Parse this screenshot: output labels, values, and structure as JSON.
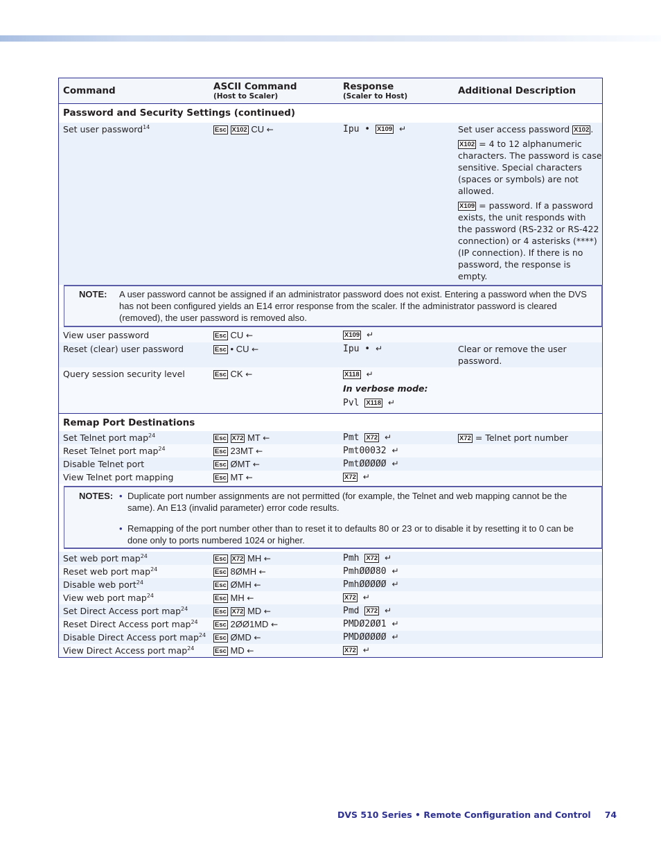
{
  "header": {
    "col_command": "Command",
    "col_ascii": "ASCII Command",
    "col_ascii_sub": "(Host to Scaler)",
    "col_response": "Response",
    "col_response_sub": "(Scaler to Host)",
    "col_description": "Additional Description"
  },
  "symbols": {
    "esc": "Esc",
    "x102": "X102",
    "x109": "X109",
    "x118": "X118",
    "x72": "X72",
    "enter_arrow": "←",
    "return_arrow": "↵",
    "bullet": "•"
  },
  "sections": {
    "password": {
      "title": "Password and Security Settings (continued)",
      "set_user_password": {
        "command": "Set user password",
        "footnote": "14",
        "ascii_suffix": "CU",
        "response_prefix": "Ipu •",
        "description_line1": "Set user access password",
        "description_x102": "= 4 to 12 alphanumeric characters. The password is case sensitive. Special characters (spaces or symbols) are not allowed.",
        "description_x109": "= password. If a password exists, the unit responds with the password (RS-232 or RS-422 connection) or 4 asterisks (****) (IP connection). If there is no password, the response is empty."
      },
      "note": {
        "label": "NOTE:",
        "text": "A user password cannot be assigned if an administrator password does not exist. Entering a password when the DVS has not been configured yields an E14 error response from the scaler. If the administrator password is cleared (removed), the user password is removed also."
      },
      "view_user_password": {
        "command": "View user password",
        "ascii_suffix": "CU"
      },
      "reset_user_password": {
        "command": "Reset (clear) user password",
        "ascii_suffix": "• CU",
        "response": "Ipu •",
        "description": "Clear or remove the user password."
      },
      "query_security": {
        "command": "Query session security level",
        "ascii_suffix": "CK",
        "verbose_label": "In verbose mode:",
        "verbose_prefix": "Pvl"
      }
    },
    "remap": {
      "title": "Remap Port Destinations",
      "telnet_rows": [
        {
          "command": "Set Telnet port map",
          "footnote": "24",
          "ascii_var": true,
          "ascii_suffix": "MT",
          "response_prefix": "Pmt",
          "response_var": true,
          "description_suffix": "= Telnet port number"
        },
        {
          "command": "Reset Telnet port map",
          "footnote": "24",
          "ascii_var": false,
          "ascii_suffix": "23MT",
          "response_prefix": "Pmt00032",
          "response_var": false
        },
        {
          "command": "Disable Telnet port",
          "footnote": "",
          "ascii_var": false,
          "ascii_suffix": "ØMT",
          "response_prefix": "PmtØØØØØ",
          "response_var": false
        },
        {
          "command": "View Telnet port mapping",
          "footnote": "",
          "ascii_var": false,
          "ascii_suffix": "MT",
          "response_prefix": "",
          "response_var": true
        }
      ],
      "notes": {
        "label": "NOTES:",
        "items": [
          "Duplicate port number assignments are not permitted (for example, the Telnet and web mapping cannot be the same). An E13 (invalid parameter) error code results.",
          "Remapping of the port number other than to reset it to defaults 80 or 23 or to disable it by resetting it to 0 can be done only to ports numbered 1024 or higher."
        ]
      },
      "web_rows": [
        {
          "command": "Set web port map",
          "footnote": "24",
          "ascii_var": true,
          "ascii_suffix": "MH",
          "response_prefix": "Pmh",
          "response_var": true
        },
        {
          "command": "Reset web port map",
          "footnote": "24",
          "ascii_var": false,
          "ascii_suffix": "8ØMH",
          "response_prefix": "PmhØØØ80",
          "response_var": false
        },
        {
          "command": "Disable web port",
          "footnote": "24",
          "ascii_var": false,
          "ascii_suffix": "ØMH",
          "response_prefix": "PmhØØØØØ",
          "response_var": false
        },
        {
          "command": "View web port map",
          "footnote": "24",
          "ascii_var": false,
          "ascii_suffix": "MH",
          "response_prefix": "",
          "response_var": true
        },
        {
          "command": "Set Direct Access port map",
          "footnote": "24",
          "ascii_var": true,
          "ascii_suffix": "MD",
          "response_prefix": "Pmd",
          "response_var": true
        },
        {
          "command": "Reset Direct Access port map",
          "footnote": "24",
          "ascii_var": false,
          "ascii_suffix": "2ØØ1MD",
          "response_prefix": "PMDØ2ØØ1",
          "response_var": false
        },
        {
          "command": "Disable Direct Access port map",
          "footnote": "24",
          "ascii_var": false,
          "ascii_suffix": "ØMD",
          "response_prefix": "PMDØØØØØ",
          "response_var": false
        },
        {
          "command": "View Direct Access port map",
          "footnote": "24",
          "ascii_var": false,
          "ascii_suffix": "MD",
          "response_prefix": "",
          "response_var": true
        }
      ]
    }
  },
  "footer": {
    "title": "DVS 510 Series • Remote Configuration and Control",
    "page": "74"
  },
  "colors": {
    "brand_blue": "#2e3192",
    "row_shade": "#eaf1fa"
  }
}
